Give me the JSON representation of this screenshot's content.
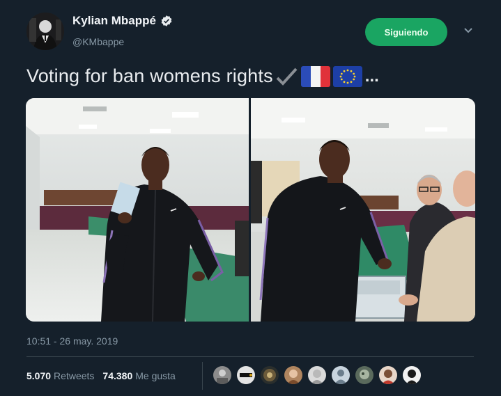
{
  "user": {
    "display_name": "Kylian Mbappé",
    "handle": "@KMbappe",
    "verified_icon": "verified-badge-icon",
    "avatar": "profile-avatar"
  },
  "follow_button": {
    "label": "Siguiendo",
    "color": "#1aa562"
  },
  "menu_icon": "chevron-down-icon",
  "tweet": {
    "text": "Voting for ban womens rights",
    "emoji_icons": [
      "checkmark-icon",
      "france-flag-icon",
      "eu-flag-icon"
    ],
    "ellipsis": "...",
    "timestamp": "10:51 - 26 may. 2019"
  },
  "photos": [
    "photo-voting-hall-holding-card",
    "photo-voting-ballot-box"
  ],
  "stats": {
    "retweets_count": "5.070",
    "retweets_label": "Retweets",
    "likes_count": "74.380",
    "likes_label": "Me gusta"
  },
  "likers": [
    "liker-avatar-1",
    "liker-avatar-2",
    "liker-avatar-3",
    "liker-avatar-4",
    "liker-avatar-5",
    "liker-avatar-6",
    "liker-avatar-7",
    "liker-avatar-8",
    "liker-avatar-9"
  ],
  "colors": {
    "background": "#15202b",
    "secondary_text": "#8899a6",
    "divider": "#38444d"
  }
}
